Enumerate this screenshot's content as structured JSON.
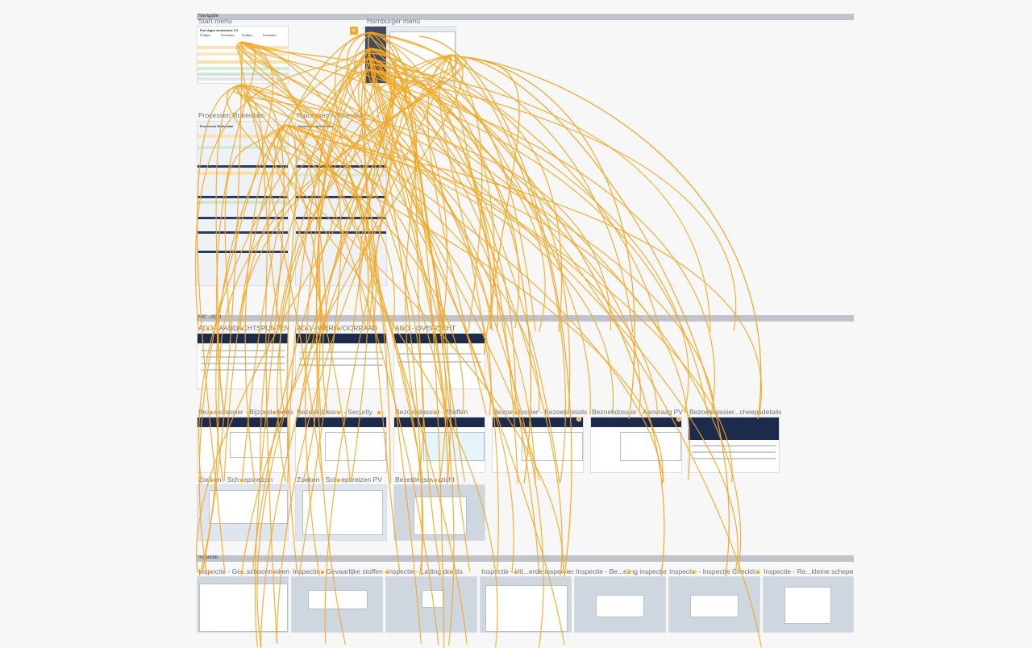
{
  "bands": [
    {
      "label": "Navigatie"
    },
    {
      "label": "NIC - ADO"
    },
    {
      "label": "Inspectie"
    }
  ],
  "frames": [
    {
      "title": "Start menu",
      "style": "white"
    },
    {
      "title": "Hamburger menu",
      "style": "hamburger"
    },
    {
      "title": "Processen Rotterdam",
      "style": "process"
    },
    {
      "title": "Processen Amsterdam",
      "style": "process"
    },
    {
      "title": "ADO - AANDACHTSPUNTEN",
      "style": "app"
    },
    {
      "title": "ADO - WERKVOORRAAD",
      "style": "app"
    },
    {
      "title": "ADO - OVERZICHT",
      "style": "app"
    },
    {
      "title": "Bezoekdossier - Bijzonderheden",
      "style": "app"
    },
    {
      "title": "Bezoekdossier - Security",
      "style": "app"
    },
    {
      "title": "Bezoekdossier - Stoffen",
      "style": "app"
    },
    {
      "title": "Bezoekdossier - Bezoekdetails",
      "style": "app"
    },
    {
      "title": "Bezoekdossier - Aanvraag PV",
      "style": "app"
    },
    {
      "title": "Bezoekdossier...cheepsdetails",
      "style": "app"
    },
    {
      "title": "Zoeken - Scheepsreizen",
      "style": "app"
    },
    {
      "title": "Zoeken - Scheepsreizen PV",
      "style": "app"
    },
    {
      "title": "Bezettingsoverzicht",
      "style": "grey"
    },
    {
      "title": "Inspectie - Ge...schoonmaken",
      "style": "grey"
    },
    {
      "title": "Inspectie - Gevaarlijke stoffen nieuw",
      "style": "grey"
    },
    {
      "title": "Inspectie - Lading details",
      "style": "grey"
    },
    {
      "title": "Inspectie - Uit...erde inspecties",
      "style": "grey"
    },
    {
      "title": "Inspectie - Be...eling inspectie",
      "style": "grey"
    },
    {
      "title": "Inspectie - Inspectie Checklist",
      "style": "grey"
    },
    {
      "title": "Inspectie - Re...kleine schepen",
      "style": "grey"
    }
  ],
  "start_menu": {
    "heading": "Port Apps versiezone 2.0",
    "columns": [
      "Profiljan",
      "Processen",
      "Profiljan",
      "Processen"
    ]
  },
  "process_headings": [
    "Processen Rotterdam",
    "Processen Amsterdam"
  ],
  "back_button": {
    "glyph": "<"
  },
  "colors": {
    "flow": "#f5a623",
    "band": "#bfc4cc",
    "navy": "#1c2a4c",
    "artboard_grey": "#ced7e0",
    "canvas": "#f7f7f7"
  }
}
